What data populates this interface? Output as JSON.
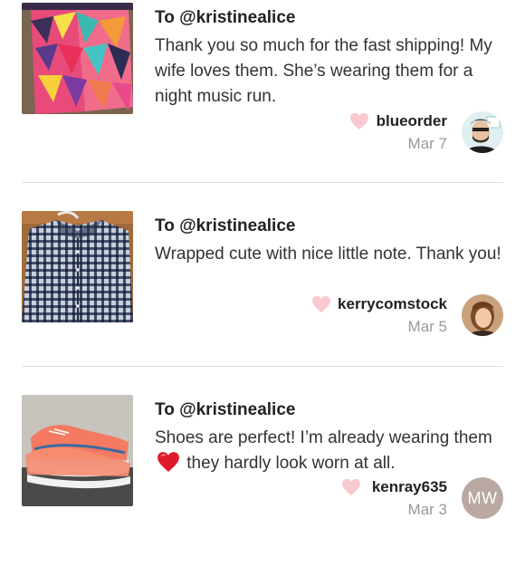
{
  "reviews": [
    {
      "to": "To @kristinealice",
      "text": "Thank you so much for the fast shipping! My wife loves them. She’s wearing them for a night music run.",
      "username": "blueorder",
      "date": "Mar 7",
      "thumb_icon": "geometric-leggings-photo",
      "avatar_icon": "user-photo-blueorder"
    },
    {
      "to": "To @kristinealice",
      "text": "Wrapped cute with nice little note. Thank you!",
      "username": "kerrycomstock",
      "date": "Mar 5",
      "thumb_icon": "plaid-shirt-photo",
      "avatar_icon": "user-photo-kerrycomstock"
    },
    {
      "to": "To @kristinealice",
      "text_before": "Shoes are perfect! I’m already wearing them",
      "text_after": "they hardly look worn at all.",
      "username": "kenray635",
      "date": "Mar 3",
      "avatar_initials": "MW",
      "thumb_icon": "running-shoes-photo"
    }
  ],
  "colors": {
    "heart": "#f9c9cf",
    "divider": "#dedede",
    "date": "#999999",
    "initials_avatar_bg": "#b9a9a2",
    "red_heart_emoji": "#e0182d"
  }
}
